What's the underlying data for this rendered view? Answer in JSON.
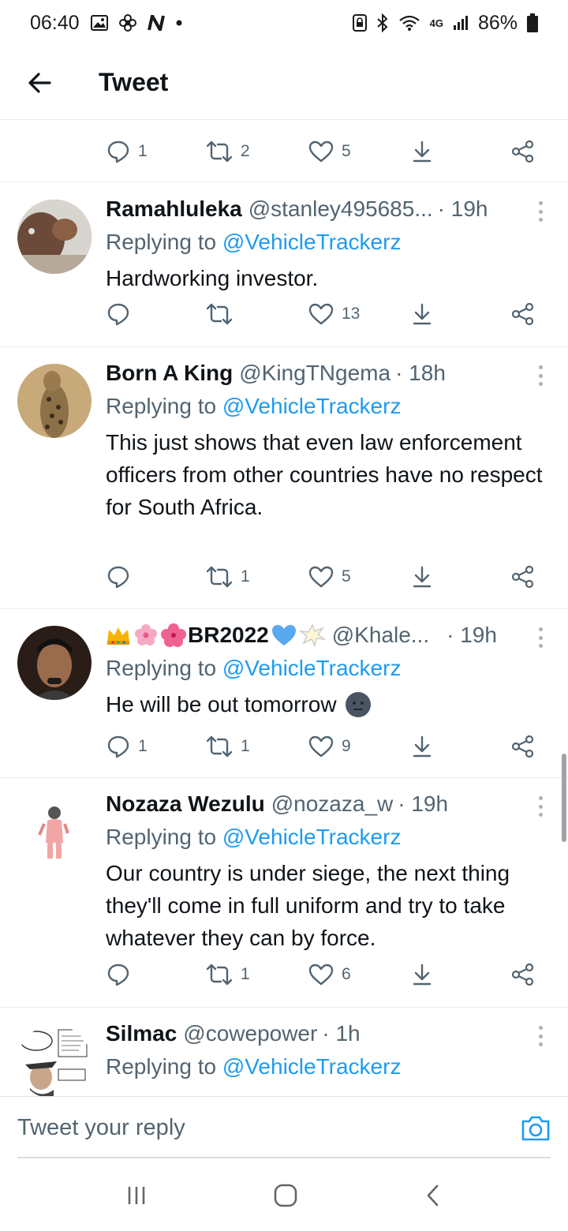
{
  "status_bar": {
    "time": "06:40",
    "network": "4G",
    "battery": "86%"
  },
  "header": {
    "title": "Tweet"
  },
  "top_actions": {
    "replies": "1",
    "retweets": "2",
    "likes": "5"
  },
  "tweets": [
    {
      "name": "Ramahluleka",
      "handle": "@stanley495685...",
      "time": "· 19h",
      "replying_label": "Replying to",
      "replying_to": "@VehicleTrackerz",
      "text": "Hardworking investor.",
      "replies": "",
      "retweets": "",
      "likes": "13"
    },
    {
      "name": "Born A King",
      "handle": "@KingTNgema",
      "time": "· 18h",
      "replying_label": "Replying to",
      "replying_to": "@VehicleTrackerz",
      "text": "This just shows that even law enforcement officers from other countries have no respect for South Africa.",
      "replies": "",
      "retweets": "1",
      "likes": "5"
    },
    {
      "name": "BR2022",
      "handle": "@Khale...",
      "time": "· 19h",
      "replying_label": "Replying to",
      "replying_to": "@VehicleTrackerz",
      "text": "He will be out tomorrow",
      "replies": "1",
      "retweets": "1",
      "likes": "9"
    },
    {
      "name": "Nozaza Wezulu",
      "handle": "@nozaza_w",
      "time": "· 19h",
      "replying_label": "Replying to",
      "replying_to": "@VehicleTrackerz",
      "text": "Our country is under siege, the next thing they'll come in full uniform and try to take whatever they can by force.",
      "replies": "",
      "retweets": "1",
      "likes": "6"
    },
    {
      "name": "Silmac",
      "handle": "@cowepower",
      "time": "· 1h",
      "replying_label": "Replying to",
      "replying_to": "@VehicleTrackerz",
      "text": ""
    }
  ],
  "reply_bar": {
    "placeholder": "Tweet your reply"
  },
  "colors": {
    "accent": "#1d9bf0",
    "secondary_text": "#536471",
    "divider": "#e6ecf0"
  }
}
